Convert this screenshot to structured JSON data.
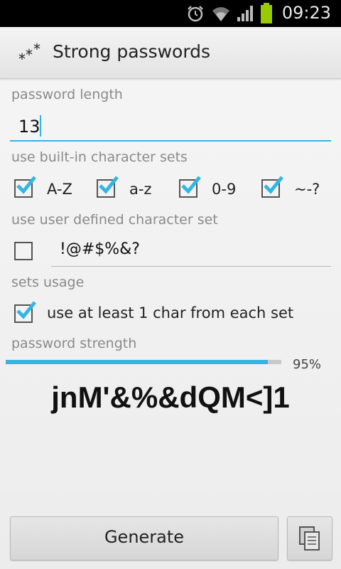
{
  "status_bar": {
    "time": "09:23"
  },
  "app": {
    "title": "Strong passwords"
  },
  "length_section": {
    "label": "password length",
    "value": "13"
  },
  "builtin_sets": {
    "label": "use built-in character sets",
    "items": [
      {
        "label": "A-Z",
        "checked": true
      },
      {
        "label": "a-z",
        "checked": true
      },
      {
        "label": "0-9",
        "checked": true
      },
      {
        "label": "~-?",
        "checked": true
      }
    ]
  },
  "user_set": {
    "label": "use user defined character set",
    "value": "!@#$%&?",
    "checked": false
  },
  "sets_usage": {
    "label": "sets usage",
    "option_label": "use at least 1 char from each set",
    "checked": true
  },
  "strength": {
    "label": "password strength",
    "percent_text": "95%",
    "percent": 95
  },
  "password": {
    "value": "jnM'&%&dQM<]1"
  },
  "buttons": {
    "generate": "Generate"
  },
  "colors": {
    "accent": "#33b5e5",
    "battery": "#99cc00"
  }
}
